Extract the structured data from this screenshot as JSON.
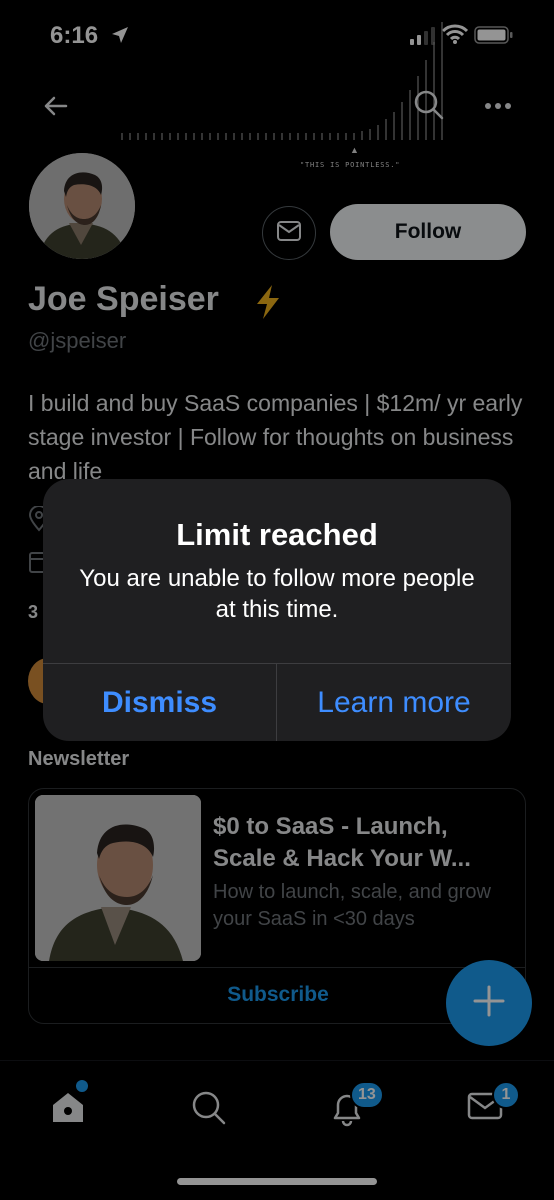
{
  "status_bar": {
    "time": "6:16"
  },
  "banner": {
    "caption": "\"THIS IS POINTLESS.\""
  },
  "profile": {
    "follow_label": "Follow",
    "name": "Joe Speiser",
    "handle": "@jspeiser",
    "bio": "I build and buy SaaS companies | $12m/ yr early stage investor | Follow for thoughts on business and life",
    "count_peek": "3"
  },
  "newsletter": {
    "section_label": "Newsletter",
    "title": "$0 to SaaS - Launch, Scale & Hack Your W...",
    "description": "How to launch, scale, and grow your SaaS in <30 days",
    "subscribe_label": "Subscribe"
  },
  "alert": {
    "title": "Limit reached",
    "message": "You are unable to follow more people at this time.",
    "dismiss_label": "Dismiss",
    "learn_more_label": "Learn more"
  },
  "tabbar": {
    "notifications_badge": "13",
    "messages_badge": "1"
  },
  "colors": {
    "accent": "#1d9bf0",
    "alert_button": "#3e8dff",
    "alert_bg": "#1f1f21",
    "muted_text": "#71767b"
  },
  "icons": [
    "location-arrow-icon",
    "cellular-signal-icon",
    "wifi-icon",
    "battery-icon",
    "back-arrow-icon",
    "search-icon",
    "more-icon",
    "envelope-icon",
    "lightning-bolt-icon",
    "location-pin-icon",
    "calendar-icon",
    "plus-icon",
    "home-icon",
    "bell-icon",
    "mail-icon"
  ]
}
